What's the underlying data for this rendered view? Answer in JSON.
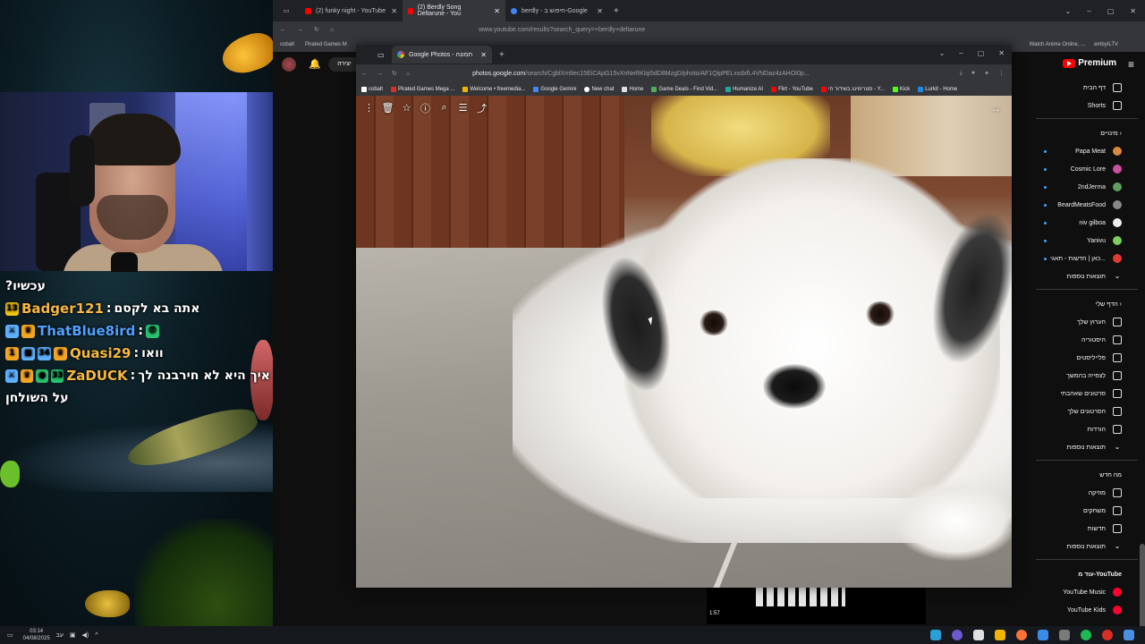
{
  "stream": {
    "chat": [
      {
        "user": "",
        "message": "עכשיו?"
      },
      {
        "badges": [
          "13"
        ],
        "user": "Badger121",
        "message": "אתה בא לקסם",
        "color": "#f5b942"
      },
      {
        "badges": [
          "sword",
          "crown"
        ],
        "user": "ThatBlue8ird",
        "message": "",
        "emote": "😨",
        "color": "#4fa1ff"
      },
      {
        "badges": [
          "1",
          "gift",
          "34",
          "crown"
        ],
        "user": "Quasi29",
        "message": "וואו",
        "color": "#f5b942"
      },
      {
        "badges": [
          "sword",
          "crown",
          "globe",
          "33"
        ],
        "user": "ZaDUCK",
        "message": "איך היא לא חירבנה לך",
        "color": "#f5a623"
      },
      {
        "user": "",
        "message": "על השולחן"
      }
    ]
  },
  "yt_browser": {
    "tabs": [
      {
        "label": "(2) funky night - YouTube"
      },
      {
        "label": "(2) Berdly Song Deltarune - You"
      },
      {
        "label": "berdly - חיפוש ב-Google"
      }
    ],
    "url": "www.youtube.com/results?search_query=+berdly+deltarune",
    "bookmarks": [
      "cobalt",
      "Pirated Games M"
    ],
    "bookmarks_right": [
      "Watch Anime Online, ...",
      "embyILTV"
    ],
    "create_label": "יצירה",
    "premium_label": "Premium",
    "sidebar": {
      "top": [
        {
          "label": "דף הבית",
          "icon": "home-icon"
        },
        {
          "label": "Shorts",
          "icon": "shorts-icon"
        }
      ],
      "subs_title": "מינויים",
      "subs": [
        {
          "label": "Papa Meat",
          "color": "#d88a3a"
        },
        {
          "label": "Cosmic Lore",
          "color": "#cc4fa0"
        },
        {
          "label": "2ndJerma",
          "color": "#5f9e5f"
        },
        {
          "label": "BeardMeatsFood",
          "color": "#888888"
        },
        {
          "label": "niv gilboa",
          "color": "#eeeeee"
        },
        {
          "label": "Yanivu",
          "color": "#7bcf5a"
        },
        {
          "label": "כאן | חדשות - תאגי...",
          "color": "#e03b2f"
        }
      ],
      "more_label": "תוצאות נוספות",
      "you_title": "הדף שלי",
      "you_items": [
        {
          "label": "הערוץ שלך",
          "icon": "channel-icon"
        },
        {
          "label": "היסטוריה",
          "icon": "history-icon"
        },
        {
          "label": "פלייליסטים",
          "icon": "playlist-icon"
        },
        {
          "label": "לצפייה בהמשך",
          "icon": "watch-later-icon"
        },
        {
          "label": "סרטונים שאהבתי",
          "icon": "like-icon"
        },
        {
          "label": "הסרטונים שלך",
          "icon": "video-icon"
        },
        {
          "label": "הורדות",
          "icon": "download-icon"
        }
      ],
      "you_more": "תוצאות נוספות",
      "new_title": "מה חדש",
      "new_items": [
        {
          "label": "מוזיקה",
          "icon": "music-icon"
        },
        {
          "label": "משחקים",
          "icon": "gaming-icon"
        },
        {
          "label": "חדשות",
          "icon": "news-icon"
        }
      ],
      "new_more": "תוצאות נוספות",
      "more_from": "עוד מ-YouTube",
      "more_from_items": [
        {
          "label": "YouTube Music",
          "color": "#ff0033"
        },
        {
          "label": "YouTube Kids",
          "color": "#ff0033"
        }
      ]
    },
    "video_time": "1:57"
  },
  "gp_browser": {
    "tab_label": "Google Photos - תמונה",
    "url_host": "photos.google.com",
    "url_path": "/search/CgblXm9ec15EiCApG15vXnNeRKlqi5dD8MzgD/photo/AF1QipPELxsdxfL4VNDaz4zAHOI0p...",
    "bookmarks": [
      {
        "label": "cobalt",
        "color": "#ffffff"
      },
      {
        "label": "Pirated Games Mega ...",
        "color": "#d93025"
      },
      {
        "label": "Welcome • freemedia...",
        "color": "#f0b400"
      },
      {
        "label": "Google Gemini",
        "color": "#4285f4"
      },
      {
        "label": "New chat",
        "color": "#ffffff"
      },
      {
        "label": "Home",
        "color": "#e0e0e0"
      },
      {
        "label": "Game Deals - Find Vid...",
        "color": "#4caf50"
      },
      {
        "label": "Humanize AI",
        "color": "#26a69a"
      },
      {
        "label": "Flirt - YouTube",
        "color": "#ff0000"
      },
      {
        "label": "סטרימינג בשידור חי - Y...",
        "color": "#ff0000"
      },
      {
        "label": "Kick",
        "color": "#53fc18"
      },
      {
        "label": "Lurkit - Home",
        "color": "#1e88e5"
      }
    ]
  },
  "taskbar": {
    "time": "03:14",
    "date": "04/08/2025",
    "lang": "עב"
  }
}
